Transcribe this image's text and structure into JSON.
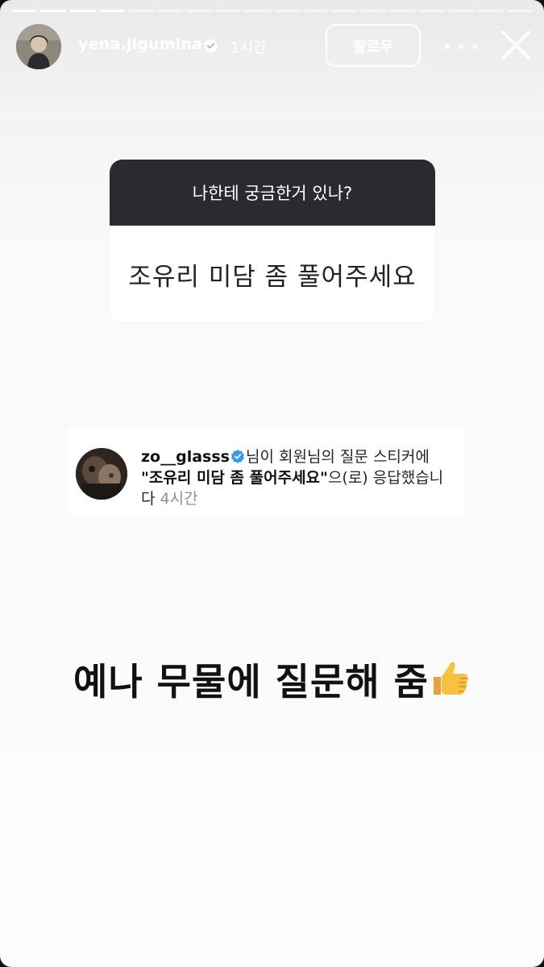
{
  "story": {
    "progress": {
      "segments_total": 18,
      "segments_viewed": 4
    }
  },
  "header": {
    "username": "yena.jigumina",
    "verified": true,
    "time": "1시간",
    "follow_label": "팔로우",
    "more_icon": "more-horizontal-icon",
    "close_icon": "close-icon"
  },
  "question_sticker": {
    "question": "나한테 궁금한거 있나?",
    "answer": "조유리 미담 좀 풀어주세요"
  },
  "reply": {
    "username": "zo__glasss",
    "verified": true,
    "text_after_name": "님이 회원님의 질문 스티커에",
    "quoted_answer": "\"조유리 미담 좀 풀어주세요\"",
    "text_after_quote": "으(로) 응답했습니",
    "text_tail": "다",
    "time": "4시간"
  },
  "caption": {
    "text": "예나 무물에 질문해 줌",
    "emoji": "thumbs-up-icon"
  },
  "colors": {
    "sticker_header_bg": "#2a2b2e",
    "verified_blue": "#3897f0",
    "muted_text": "#8e8e8e"
  }
}
